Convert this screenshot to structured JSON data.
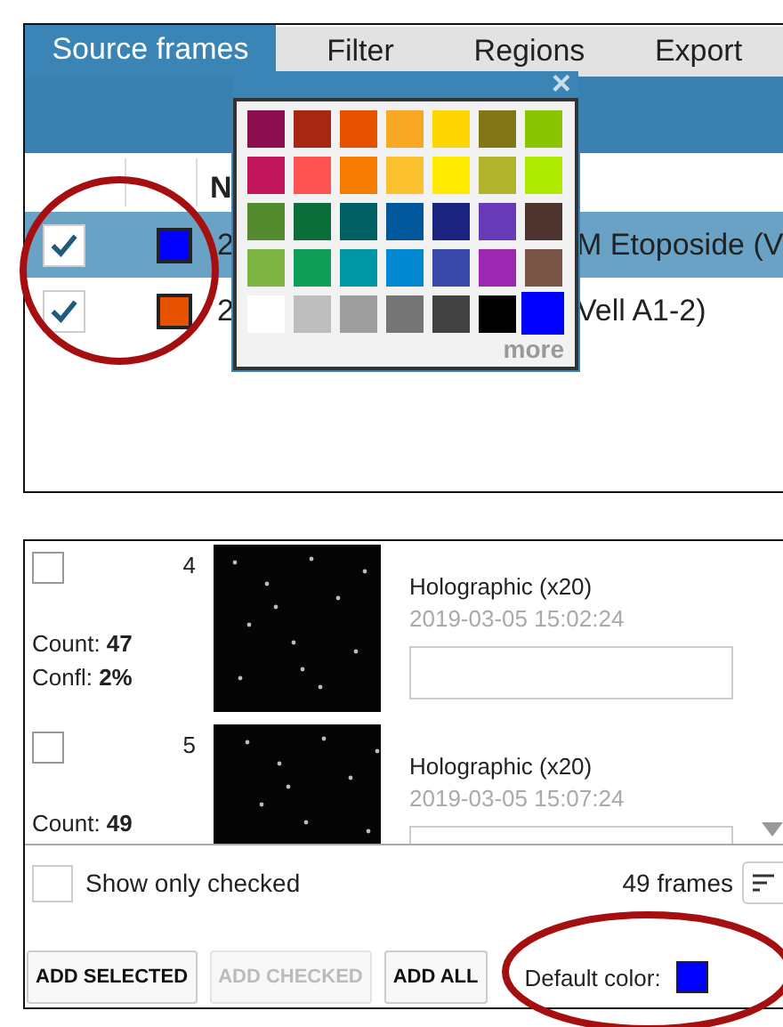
{
  "tabs": [
    {
      "label": "Source frames",
      "selected": true
    },
    {
      "label": "Filter",
      "selected": false
    },
    {
      "label": "Regions",
      "selected": false
    },
    {
      "label": "Export",
      "selected": false
    }
  ],
  "table": {
    "header": "N",
    "rows": [
      {
        "checked": true,
        "selected": true,
        "color": "#0000ff",
        "name_start": "2",
        "name_end": "M Etoposide (V"
      },
      {
        "checked": true,
        "selected": false,
        "color": "#e65100",
        "name_start": "2",
        "name_end": "Vell A1-2)"
      }
    ]
  },
  "color_picker": {
    "close": "×",
    "more": "more",
    "swatches": [
      {
        "color": "#8b0e4e",
        "selected": false
      },
      {
        "color": "#a52714",
        "selected": false
      },
      {
        "color": "#e65100",
        "selected": false
      },
      {
        "color": "#f9a825",
        "selected": false
      },
      {
        "color": "#ffd600",
        "selected": false
      },
      {
        "color": "#817717",
        "selected": false
      },
      {
        "color": "#8bc400",
        "selected": false
      },
      {
        "color": "#c2185b",
        "selected": false
      },
      {
        "color": "#ff5252",
        "selected": false
      },
      {
        "color": "#f57c00",
        "selected": false
      },
      {
        "color": "#fbc02d",
        "selected": false
      },
      {
        "color": "#ffea00",
        "selected": false
      },
      {
        "color": "#afb42b",
        "selected": false
      },
      {
        "color": "#aeea00",
        "selected": false
      },
      {
        "color": "#558b2f",
        "selected": false
      },
      {
        "color": "#0b6e3a",
        "selected": false
      },
      {
        "color": "#006064",
        "selected": false
      },
      {
        "color": "#01579b",
        "selected": false
      },
      {
        "color": "#1a237e",
        "selected": false
      },
      {
        "color": "#673ab7",
        "selected": false
      },
      {
        "color": "#4e342e",
        "selected": false
      },
      {
        "color": "#7cb342",
        "selected": false
      },
      {
        "color": "#0f9d58",
        "selected": false
      },
      {
        "color": "#0097a7",
        "selected": false
      },
      {
        "color": "#0288d1",
        "selected": false
      },
      {
        "color": "#3949ab",
        "selected": false
      },
      {
        "color": "#9c27b0",
        "selected": false
      },
      {
        "color": "#795548",
        "selected": false
      },
      {
        "color": "#ffffff",
        "selected": false
      },
      {
        "color": "#bdbdbd",
        "selected": false
      },
      {
        "color": "#9e9e9e",
        "selected": false
      },
      {
        "color": "#757575",
        "selected": false
      },
      {
        "color": "#424242",
        "selected": false
      },
      {
        "color": "#000000",
        "selected": false
      },
      {
        "color": "#0000ff",
        "selected": true
      }
    ]
  },
  "frames": {
    "items": [
      {
        "checked": false,
        "number": "4",
        "count": "Count: **47**",
        "confl": "Confl: **2%**",
        "title": "Holographic (x20)",
        "date": "2019-03-05 15:02:24"
      },
      {
        "checked": false,
        "number": "5",
        "count": "Count: **49**",
        "title": "Holographic (x20)",
        "date": "2019-03-05 15:07:24"
      }
    ],
    "show_only_checked": {
      "label": "Show only checked",
      "checked": false
    },
    "count": "49 frames",
    "buttons": [
      {
        "label": "ADD SELECTED",
        "disabled": false
      },
      {
        "label": "ADD CHECKED",
        "disabled": true
      },
      {
        "label": "ADD ALL",
        "disabled": false
      }
    ],
    "default_color": {
      "label": "Default color:",
      "color": "#0000ff"
    }
  }
}
